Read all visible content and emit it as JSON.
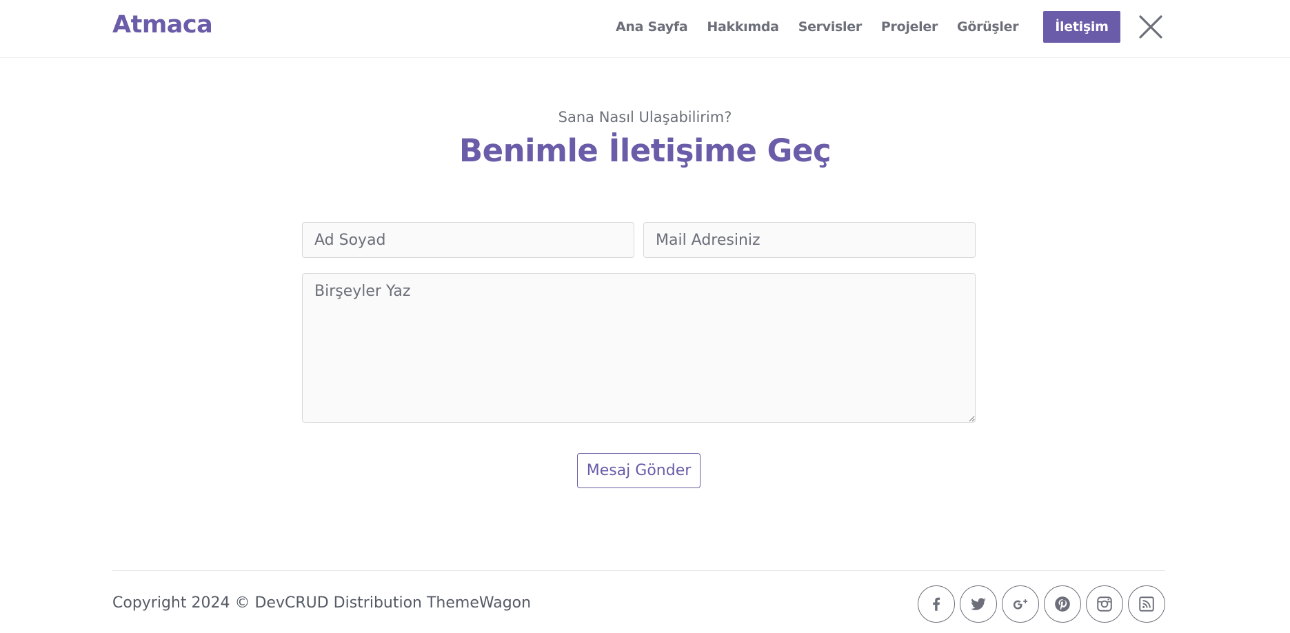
{
  "brand": {
    "name": "Atmaca",
    "color": "#6a5ca8"
  },
  "nav": {
    "items": [
      {
        "label": "Ana Sayfa"
      },
      {
        "label": "Hakkımda"
      },
      {
        "label": "Servisler"
      },
      {
        "label": "Projeler"
      },
      {
        "label": "Görüşler"
      },
      {
        "label": "İletişim",
        "active": true
      }
    ],
    "close_icon": "close-icon"
  },
  "contact": {
    "subtitle": "Sana Nasıl Ulaşabilirim?",
    "title": "Benimle İletişime Geç",
    "name_placeholder": "Ad Soyad",
    "mail_placeholder": "Mail Adresiniz",
    "message_placeholder": "Birşeyler Yaz",
    "submit_label": "Mesaj Gönder"
  },
  "footer": {
    "copyright": "Copyright 2024 © DevCRUD Distribution ThemeWagon",
    "social_icons": [
      "facebook-icon",
      "twitter-icon",
      "google-plus-icon",
      "pinterest-icon",
      "instagram-icon",
      "rss-icon"
    ]
  },
  "colors": {
    "accent": "#6a5ca8",
    "text": "#555a64",
    "muted": "#6c6f79"
  }
}
